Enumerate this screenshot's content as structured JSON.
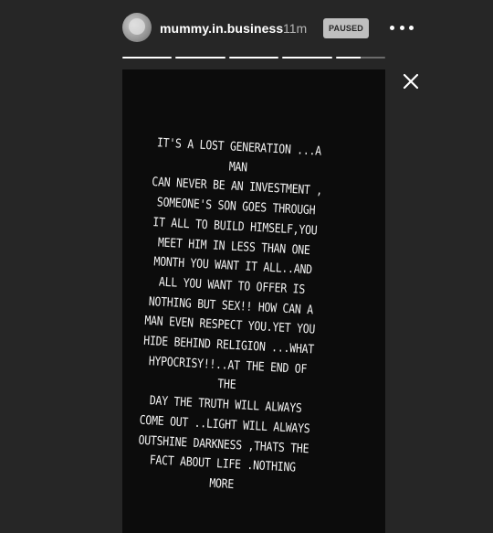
{
  "header": {
    "username": "mummy.in.business",
    "time": "11m",
    "status_badge": "PAUSED",
    "more_icon": "more-horizontal-icon",
    "avatar_icon": "profile-avatar"
  },
  "progress": {
    "segments_complete": 4,
    "segments_total": 5,
    "current_segment_fraction": 0.5
  },
  "close_icon": "close-icon",
  "story": {
    "text": "IT'S A LOST GENERATION ...A MAN\nCAN NEVER BE AN INVESTMENT ,\nSOMEONE'S SON GOES THROUGH\nIT ALL TO BUILD HIMSELF,YOU\nMEET HIM IN LESS THAN ONE\nMONTH YOU WANT IT ALL..AND\nALL YOU WANT TO OFFER IS\nNOTHING BUT SEX!! HOW CAN A\nMAN EVEN RESPECT YOU.YET YOU\nHIDE BEHIND RELIGION ...WHAT\nHYPOCRISY!!..AT THE END OF THE\nDAY THE TRUTH WILL ALWAYS\nCOME OUT ..LIGHT WILL ALWAYS\nOUTSHINE DARKNESS ,THATS THE\nFACT ABOUT LIFE .NOTHING MORE",
    "background_color": "#0c0c0c",
    "text_color": "#f2f2f2"
  },
  "colors": {
    "page_background": "#262626",
    "badge_background": "#bfbfbf"
  }
}
